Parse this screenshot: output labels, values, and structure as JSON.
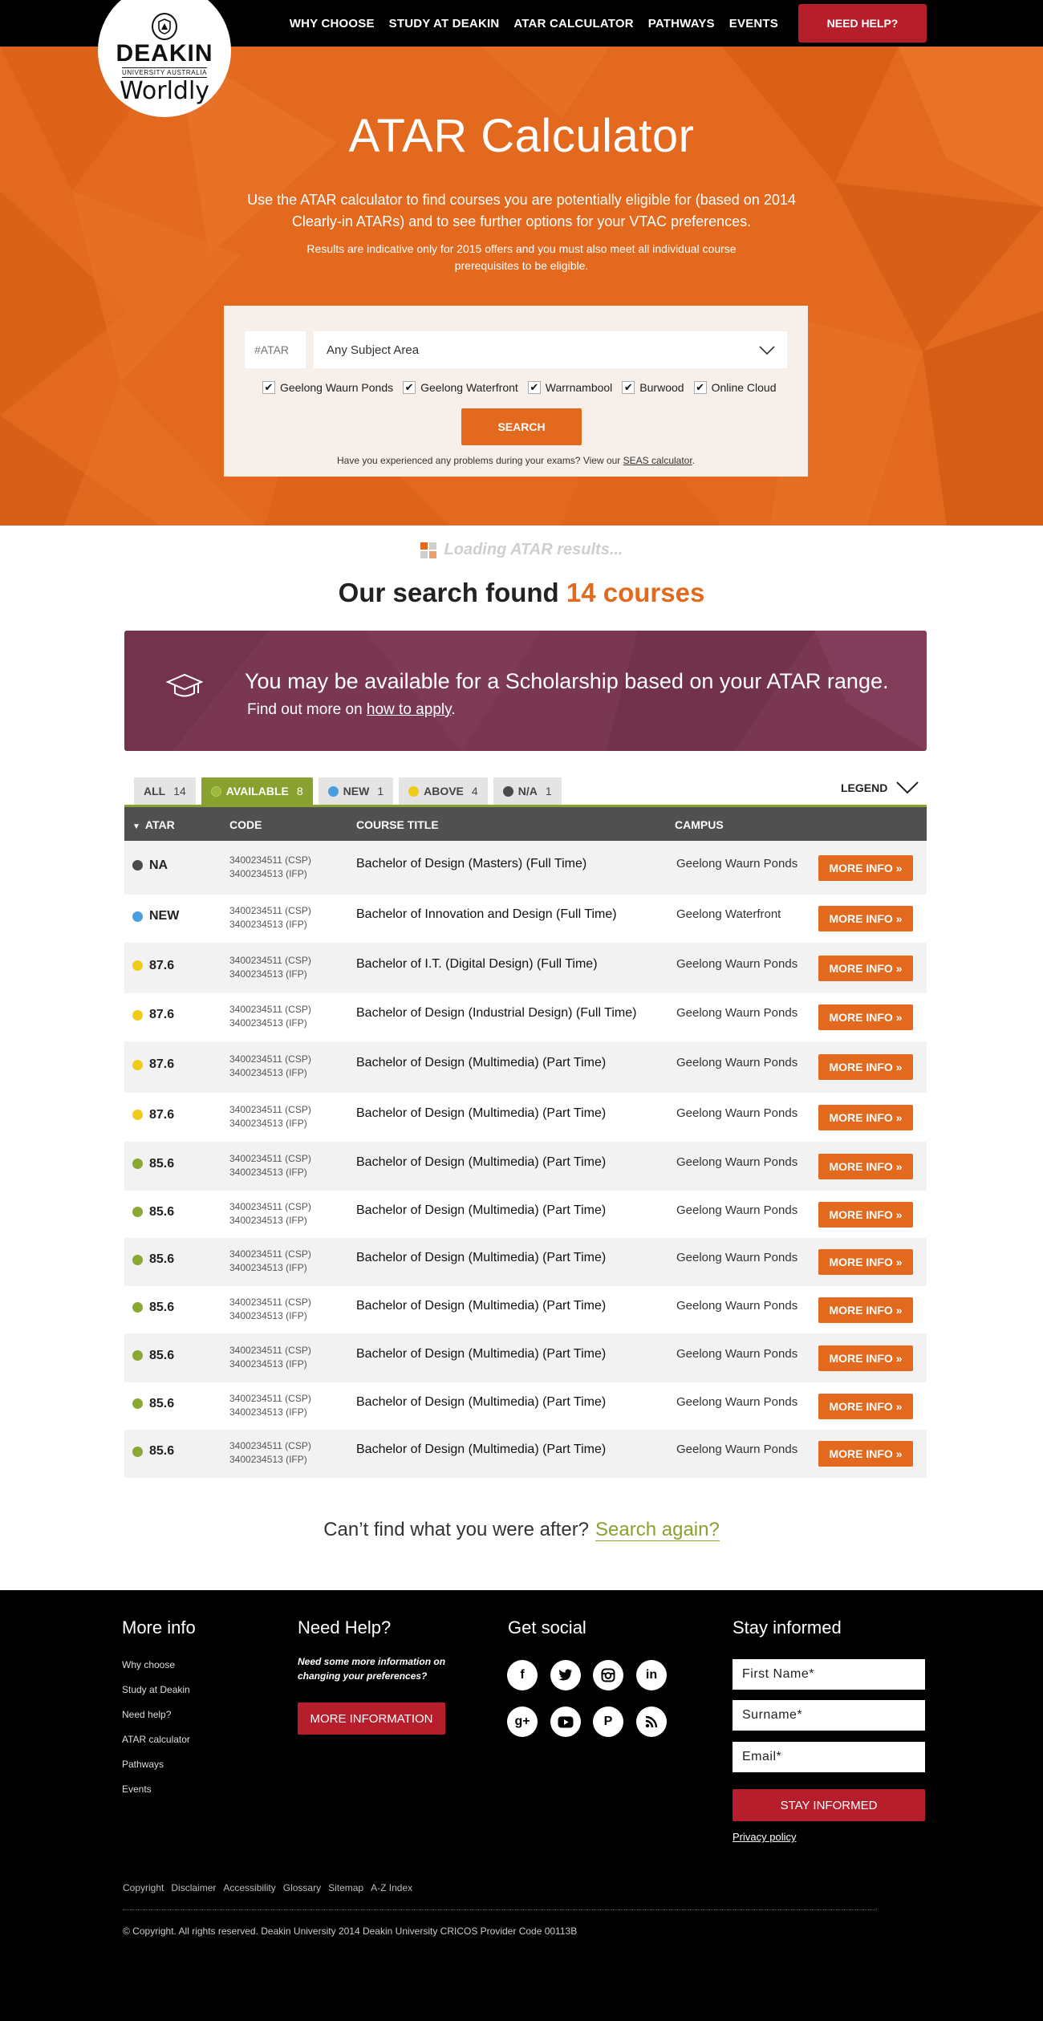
{
  "nav": {
    "items": [
      "WHY CHOOSE",
      "STUDY AT DEAKIN",
      "ATAR CALCULATOR",
      "PATHWAYS",
      "EVENTS"
    ],
    "help_label": "NEED HELP?"
  },
  "logo": {
    "name": "DEAKIN",
    "subtitle": "UNIVERSITY AUSTRALIA",
    "tagline": "Worldly"
  },
  "hero": {
    "title": "ATAR Calculator",
    "subtitle": "Use the ATAR calculator to find courses you are potentially eligible for (based on 2014 Clearly-in ATARs) and to see further options for your VTAC preferences.",
    "note": "Results are indicative only for 2015 offers and you must also meet all individual course prerequisites to be eligible."
  },
  "search": {
    "atar_placeholder": "#ATAR",
    "subject_value": "Any Subject Area",
    "campuses": [
      {
        "label": "Geelong Waurn Ponds",
        "checked": true
      },
      {
        "label": "Geelong Waterfront",
        "checked": true
      },
      {
        "label": "Warrnambool",
        "checked": true
      },
      {
        "label": "Burwood",
        "checked": true
      },
      {
        "label": "Online Cloud",
        "checked": true
      }
    ],
    "button_label": "SEARCH",
    "seas_text": "Have you experienced any problems during your exams? View our ",
    "seas_link": "SEAS calculator",
    "seas_end": "."
  },
  "results": {
    "loading": "Loading ATAR results...",
    "found_prefix": "Our search found ",
    "found_count": "14 courses"
  },
  "scholarship": {
    "title": "You may be available for a Scholarship based on your ATAR range.",
    "sub_prefix": "Find out more on ",
    "sub_link": "how to apply",
    "sub_end": "."
  },
  "filters": [
    {
      "label": "ALL",
      "count": "14",
      "color": "",
      "active": false
    },
    {
      "label": "AVAILABLE",
      "count": "8",
      "color": "#8aa832",
      "active": true
    },
    {
      "label": "NEW",
      "count": "1",
      "color": "#4a9ee0",
      "active": false
    },
    {
      "label": "ABOVE",
      "count": "4",
      "color": "#f0cc1a",
      "active": false
    },
    {
      "label": "N/A",
      "count": "1",
      "color": "#4a4a4a",
      "active": false
    }
  ],
  "legend_label": "LEGEND",
  "table": {
    "headers": {
      "atar": "ATAR",
      "code": "CODE",
      "title": "COURSE TITLE",
      "campus": "CAMPUS"
    },
    "more_label": "MORE INFO »",
    "rows": [
      {
        "atar": "NA",
        "color": "#4a4a4a",
        "code1": "3400234511 (CSP)",
        "code2": "3400234513 (IFP)",
        "title": "Bachelor of Design (Masters) (Full Time)",
        "campus": "Geelong Waurn Ponds"
      },
      {
        "atar": "NEW",
        "color": "#4a9ee0",
        "code1": "3400234511 (CSP)",
        "code2": "3400234513 (IFP)",
        "title": "Bachelor of Innovation and Design (Full Time)",
        "campus": "Geelong Waterfront"
      },
      {
        "atar": "87.6",
        "color": "#f0cc1a",
        "code1": "3400234511 (CSP)",
        "code2": "3400234513 (IFP)",
        "title": "Bachelor of I.T. (Digital Design) (Full Time)",
        "campus": "Geelong Waurn Ponds"
      },
      {
        "atar": "87.6",
        "color": "#f0cc1a",
        "code1": "3400234511 (CSP)",
        "code2": "3400234513 (IFP)",
        "title": "Bachelor of Design (Industrial Design) (Full Time)",
        "campus": "Geelong Waurn Ponds"
      },
      {
        "atar": "87.6",
        "color": "#f0cc1a",
        "code1": "3400234511 (CSP)",
        "code2": "3400234513 (IFP)",
        "title": "Bachelor of Design (Multimedia) (Part Time)",
        "campus": "Geelong Waurn Ponds"
      },
      {
        "atar": "87.6",
        "color": "#f0cc1a",
        "code1": "3400234511 (CSP)",
        "code2": "3400234513 (IFP)",
        "title": "Bachelor of Design (Multimedia) (Part Time)",
        "campus": "Geelong Waurn Ponds"
      },
      {
        "atar": "85.6",
        "color": "#8aa832",
        "code1": "3400234511 (CSP)",
        "code2": "3400234513 (IFP)",
        "title": "Bachelor of Design (Multimedia) (Part Time)",
        "campus": "Geelong Waurn Ponds"
      },
      {
        "atar": "85.6",
        "color": "#8aa832",
        "code1": "3400234511 (CSP)",
        "code2": "3400234513 (IFP)",
        "title": "Bachelor of Design (Multimedia) (Part Time)",
        "campus": "Geelong Waurn Ponds"
      },
      {
        "atar": "85.6",
        "color": "#8aa832",
        "code1": "3400234511 (CSP)",
        "code2": "3400234513 (IFP)",
        "title": "Bachelor of Design (Multimedia) (Part Time)",
        "campus": "Geelong Waurn Ponds"
      },
      {
        "atar": "85.6",
        "color": "#8aa832",
        "code1": "3400234511 (CSP)",
        "code2": "3400234513 (IFP)",
        "title": "Bachelor of Design (Multimedia) (Part Time)",
        "campus": "Geelong Waurn Ponds"
      },
      {
        "atar": "85.6",
        "color": "#8aa832",
        "code1": "3400234511 (CSP)",
        "code2": "3400234513 (IFP)",
        "title": "Bachelor of Design (Multimedia) (Part Time)",
        "campus": "Geelong Waurn Ponds"
      },
      {
        "atar": "85.6",
        "color": "#8aa832",
        "code1": "3400234511 (CSP)",
        "code2": "3400234513 (IFP)",
        "title": "Bachelor of Design (Multimedia) (Part Time)",
        "campus": "Geelong Waurn Ponds"
      },
      {
        "atar": "85.6",
        "color": "#8aa832",
        "code1": "3400234511 (CSP)",
        "code2": "3400234513 (IFP)",
        "title": "Bachelor of Design (Multimedia) (Part Time)",
        "campus": "Geelong Waurn Ponds"
      }
    ]
  },
  "again": {
    "prefix": "Can’t find what you were after?",
    "link": "Search again?"
  },
  "footer": {
    "more_info": {
      "heading": "More info",
      "links": [
        "Why choose",
        "Study at Deakin",
        "Need help?",
        "ATAR calculator",
        "Pathways",
        "Events"
      ]
    },
    "need_help": {
      "heading": "Need Help?",
      "text": "Need some more information on changing your preferences?",
      "button": "MORE INFORMATION"
    },
    "social": {
      "heading": "Get social",
      "icons": [
        "facebook-icon",
        "twitter-icon",
        "instagram-icon",
        "linkedin-icon",
        "google-plus-icon",
        "youtube-icon",
        "pinterest-icon",
        "rss-icon"
      ]
    },
    "stay": {
      "heading": "Stay informed",
      "first_name": "First Name*",
      "surname": "Surname*",
      "email": "Email*",
      "button": "STAY INFORMED",
      "privacy": "Privacy policy"
    },
    "legal_links": [
      "Copyright",
      "Disclaimer",
      "Accessibility",
      "Glossary",
      "Sitemap",
      "A-Z Index"
    ],
    "copyright": "© Copyright. All rights reserved. Deakin University 2014 Deakin University CRICOS Provider Code 00113B"
  },
  "colors": {
    "orange": "#e3691f",
    "green": "#8aa832",
    "red": "#b71e2b",
    "plum": "#7a3751"
  }
}
